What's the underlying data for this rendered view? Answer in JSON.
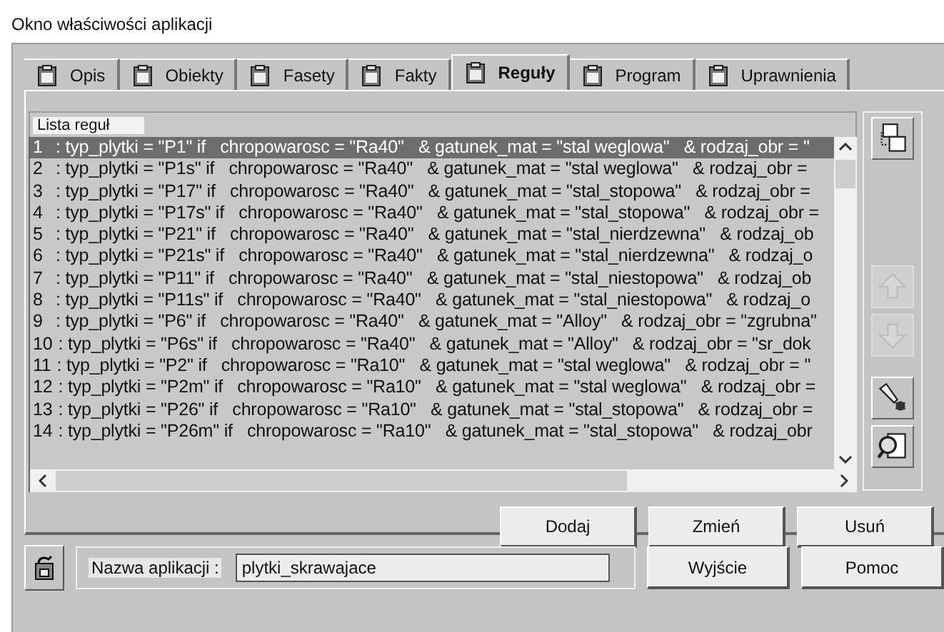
{
  "window": {
    "title": "Okno właściwości aplikacji"
  },
  "tabs": [
    {
      "label": "Opis",
      "selected": false
    },
    {
      "label": "Obiekty",
      "selected": false
    },
    {
      "label": "Fasety",
      "selected": false
    },
    {
      "label": "Fakty",
      "selected": false
    },
    {
      "label": "Reguły",
      "selected": true
    },
    {
      "label": "Program",
      "selected": false
    },
    {
      "label": "Uprawnienia",
      "selected": false
    }
  ],
  "rules_list": {
    "header": "Lista reguł",
    "rows": [
      {
        "number": "1",
        "text": ": typ_plytki = \"P1\" if   chropowarosc = \"Ra40\"   & gatunek_mat = \"stal weglowa\"   & rodzaj_obr = \"",
        "selected": true
      },
      {
        "number": "2",
        "text": ": typ_plytki = \"P1s\" if   chropowarosc = \"Ra40\"   & gatunek_mat = \"stal weglowa\"   & rodzaj_obr =",
        "selected": false
      },
      {
        "number": "3",
        "text": ": typ_plytki = \"P17\" if   chropowarosc = \"Ra40\"   & gatunek_mat = \"stal_stopowa\"   & rodzaj_obr =",
        "selected": false
      },
      {
        "number": "4",
        "text": ": typ_plytki = \"P17s\" if   chropowarosc = \"Ra40\"   & gatunek_mat = \"stal_stopowa\"   & rodzaj_obr =",
        "selected": false
      },
      {
        "number": "5",
        "text": ": typ_plytki = \"P21\" if   chropowarosc = \"Ra40\"   & gatunek_mat = \"stal_nierdzewna\"   & rodzaj_ob",
        "selected": false
      },
      {
        "number": "6",
        "text": ": typ_plytki = \"P21s\" if   chropowarosc = \"Ra40\"   & gatunek_mat = \"stal_nierdzewna\"   & rodzaj_o",
        "selected": false
      },
      {
        "number": "7",
        "text": ": typ_plytki = \"P11\" if   chropowarosc = \"Ra40\"   & gatunek_mat = \"stal_niestopowa\"   & rodzaj_ob",
        "selected": false
      },
      {
        "number": "8",
        "text": ": typ_plytki = \"P11s\" if   chropowarosc = \"Ra40\"   & gatunek_mat = \"stal_niestopowa\"   & rodzaj_o",
        "selected": false
      },
      {
        "number": "9",
        "text": ": typ_plytki = \"P6\" if   chropowarosc = \"Ra40\"   & gatunek_mat = \"Alloy\"   & rodzaj_obr = \"zgrubna\"",
        "selected": false
      },
      {
        "number": "10",
        "text": ": typ_plytki = \"P6s\" if   chropowarosc = \"Ra40\"   & gatunek_mat = \"Alloy\"   & rodzaj_obr = \"sr_dok",
        "selected": false
      },
      {
        "number": "11",
        "text": ": typ_plytki = \"P2\" if   chropowarosc = \"Ra10\"   & gatunek_mat = \"stal weglowa\"   & rodzaj_obr = \"",
        "selected": false
      },
      {
        "number": "12",
        "text": ": typ_plytki = \"P2m\" if   chropowarosc = \"Ra10\"   & gatunek_mat = \"stal weglowa\"   & rodzaj_obr =",
        "selected": false
      },
      {
        "number": "13",
        "text": ": typ_plytki = \"P26\" if   chropowarosc = \"Ra10\"   & gatunek_mat = \"stal_stopowa\"   & rodzaj_obr =",
        "selected": false
      },
      {
        "number": "14",
        "text": ": typ_plytki = \"P26m\" if   chropowarosc = \"Ra10\"   & gatunek_mat = \"stal_stopowa\"   & rodzaj_obr",
        "selected": false
      }
    ]
  },
  "tools": [
    {
      "kind": "copy",
      "disabled": false
    },
    {
      "kind": "up",
      "disabled": true
    },
    {
      "kind": "down",
      "disabled": true
    },
    {
      "kind": "debug",
      "disabled": false
    },
    {
      "kind": "preview",
      "disabled": false
    }
  ],
  "actions": [
    "Dodaj",
    "Zmień",
    "Usuń"
  ],
  "footer": {
    "label": "Nazwa aplikacji :",
    "value": "plytki_skrawajace",
    "buttons": [
      "Wyjście",
      "Pomoc"
    ]
  }
}
